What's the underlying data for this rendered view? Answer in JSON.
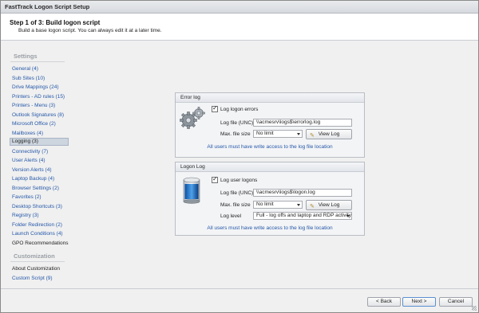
{
  "window": {
    "title": "FastTrack Logon Script Setup"
  },
  "header": {
    "step": "Step 1 of 3: Build logon script",
    "subtitle": "Build a base logon script. You can always edit it at a later time."
  },
  "sidebar": {
    "settings_title": "Settings",
    "items": [
      "General (4)",
      "Sub Sites (10)",
      "Drive Mappings (24)",
      "Printers - AD rules (15)",
      "Printers - Menu (3)",
      "Outlook Signatures (8)",
      "Microsoft Office (2)",
      "Mailboxes (4)",
      "Logging (3)",
      "Connectivity (7)",
      "User Alerts (4)",
      "Version Alerts (4)",
      "Laptop Backup (4)",
      "Browser Settings (2)",
      "Favorites (2)",
      "Desktop Shortcuts (3)",
      "Registry (3)",
      "Folder Redirection (2)",
      "Launch Conditions (4)",
      "GPO Recommendations"
    ],
    "selected": "Logging (3)",
    "customization_title": "Customization",
    "custom_items": [
      "About Customization",
      "Custom Script (9)"
    ]
  },
  "error_log": {
    "title": "Error log",
    "checkbox_label": "Log logon errors",
    "file_label": "Log file (UNC)",
    "file_value": "\\\\acmesrv\\logs$\\errorlog.log",
    "size_label": "Max. file size",
    "size_value": "No limit",
    "view_button": "View Log",
    "note": "All users must have write access to the log file location"
  },
  "logon_log": {
    "title": "Logon Log",
    "checkbox_label": "Log user logons",
    "file_label": "Log file (UNC)",
    "file_value": "\\\\acmesrv\\logs$\\logon.log",
    "size_label": "Max. file size",
    "size_value": "No limit",
    "view_button": "View Log",
    "level_label": "Log level",
    "level_value": "Full - log offs and laptop and RDP activity",
    "note": "All users must have write access to the log file location"
  },
  "footer": {
    "back": "< Back",
    "next": "Next >",
    "cancel": "Cancel"
  }
}
